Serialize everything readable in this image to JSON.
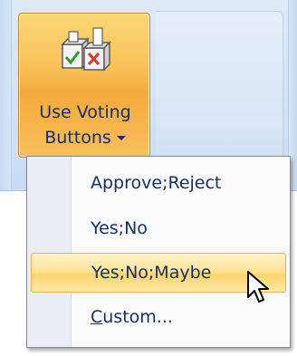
{
  "ribbon": {
    "voting_button": {
      "label_line1": "Use Voting",
      "label_line2": "Buttons",
      "icon": "ballot-boxes-icon"
    }
  },
  "dropdown": {
    "items": [
      {
        "label": "Approve;Reject",
        "highlighted": false
      },
      {
        "label": "Yes;No",
        "highlighted": false
      },
      {
        "label": "Yes;No;Maybe",
        "highlighted": true
      },
      {
        "label_underlined": "C",
        "label_rest": "ustom...",
        "highlighted": false
      }
    ]
  },
  "colors": {
    "menu_text": "#15306a",
    "button_orange": "#f8c257",
    "highlight": "#ffe39a"
  }
}
